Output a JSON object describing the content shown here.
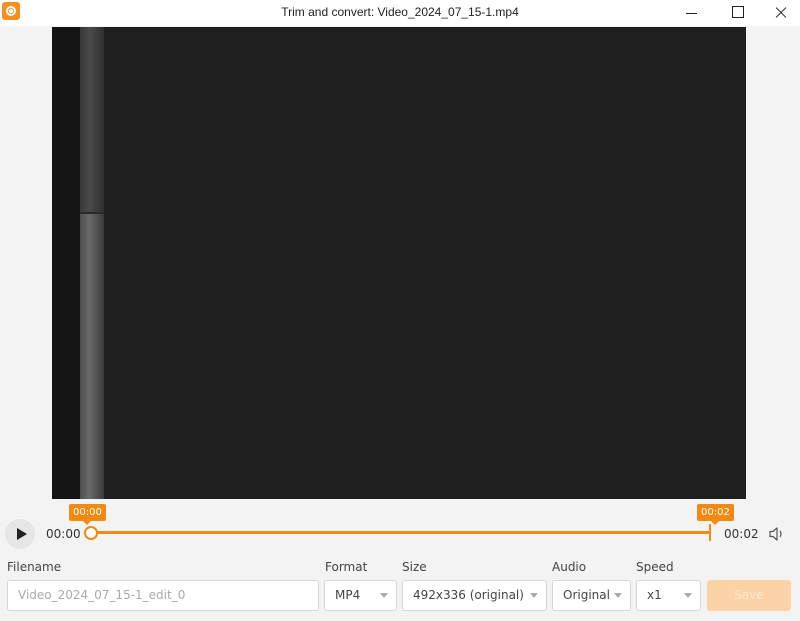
{
  "window": {
    "title": "Trim and convert: Video_2024_07_15-1.mp4",
    "accent_color": "#f08a13"
  },
  "timeline": {
    "current_time": "00:00",
    "end_time": "00:02",
    "trim_start_label": "00:00",
    "trim_end_label": "00:02"
  },
  "form": {
    "filename_label": "Filename",
    "filename_placeholder": "Video_2024_07_15-1_edit_0",
    "format_label": "Format",
    "format_value": "MP4",
    "size_label": "Size",
    "size_value": "492x336 (original)",
    "audio_label": "Audio",
    "audio_value": "Original",
    "speed_label": "Speed",
    "speed_value": "x1",
    "save_label": "Save"
  },
  "icons": {
    "app": "app-logo-icon",
    "play": "play-icon",
    "volume": "volume-icon"
  }
}
